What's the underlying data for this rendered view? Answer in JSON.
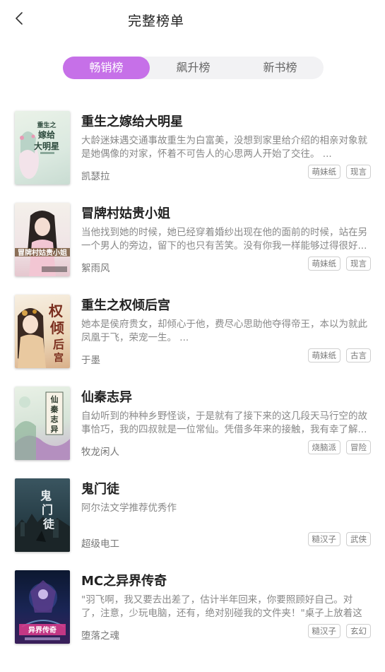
{
  "header": {
    "title": "完整榜单"
  },
  "tabs": [
    {
      "label": "畅销榜",
      "active": true
    },
    {
      "label": "飙升榜",
      "active": false
    },
    {
      "label": "新书榜",
      "active": false
    }
  ],
  "colors": {
    "accent": "#c670e8",
    "tab_bg": "#f2f2f4"
  },
  "books": [
    {
      "title": "重生之嫁给大明星",
      "description": "大龄迷妹遇交通事故重生为白富美，没想到家里给介绍的相亲对象就是她偶像的对家，怀着不可告人的心思两人开始了交往。 ...",
      "author": "凯瑟拉",
      "tags": [
        "萌妹纸",
        "现言"
      ],
      "cover_text": "重生之\n嫁给\n大明星"
    },
    {
      "title": "冒牌村姑贵小姐",
      "description": "当他找到她的时候，她已经穿着婚纱出现在他的面前的时候，站在另一个男人的旁边，留下的也只有苦笑。没有你我一样能够过得很好...",
      "author": "絮雨风",
      "tags": [
        "萌妹纸",
        "现言"
      ],
      "cover_text": "冒牌村姑贵小姐"
    },
    {
      "title": "重生之权倾后宫",
      "description": "她本是侯府贵女，却倾心于他，费尽心思助他夺得帝王，本以为就此凤凰于飞，荣宠一生。 ...",
      "author": "于墨",
      "tags": [
        "萌妹纸",
        "古言"
      ],
      "cover_text": "权倾后宫"
    },
    {
      "title": "仙秦志异",
      "description": "自幼听到的种种乡野怪谈，于是就有了接下来的这几段天马行空的故事恰巧，我的四叔就是一位常仙。凭借多年来的接触，我有幸了解...",
      "author": "牧龙闲人",
      "tags": [
        "烧脑派",
        "冒险"
      ],
      "cover_text": "仙秦志异"
    },
    {
      "title": "鬼门徒",
      "description": "阿尔法文学推荐优秀作",
      "author": "超级电工",
      "tags": [
        "糙汉子",
        "武侠"
      ],
      "cover_text": "鬼门徒"
    },
    {
      "title": "MC之异界传奇",
      "description": "\"羽飞啊，我又要去出差了，估计半年回来，你要照顾好自己。对了，注意，少玩电脑，还有，绝对别碰我的文件夹！\"桌子上放着这样一...",
      "author": "堕落之魂",
      "tags": [
        "糙汉子",
        "玄幻"
      ],
      "cover_text": "异界传奇"
    }
  ]
}
